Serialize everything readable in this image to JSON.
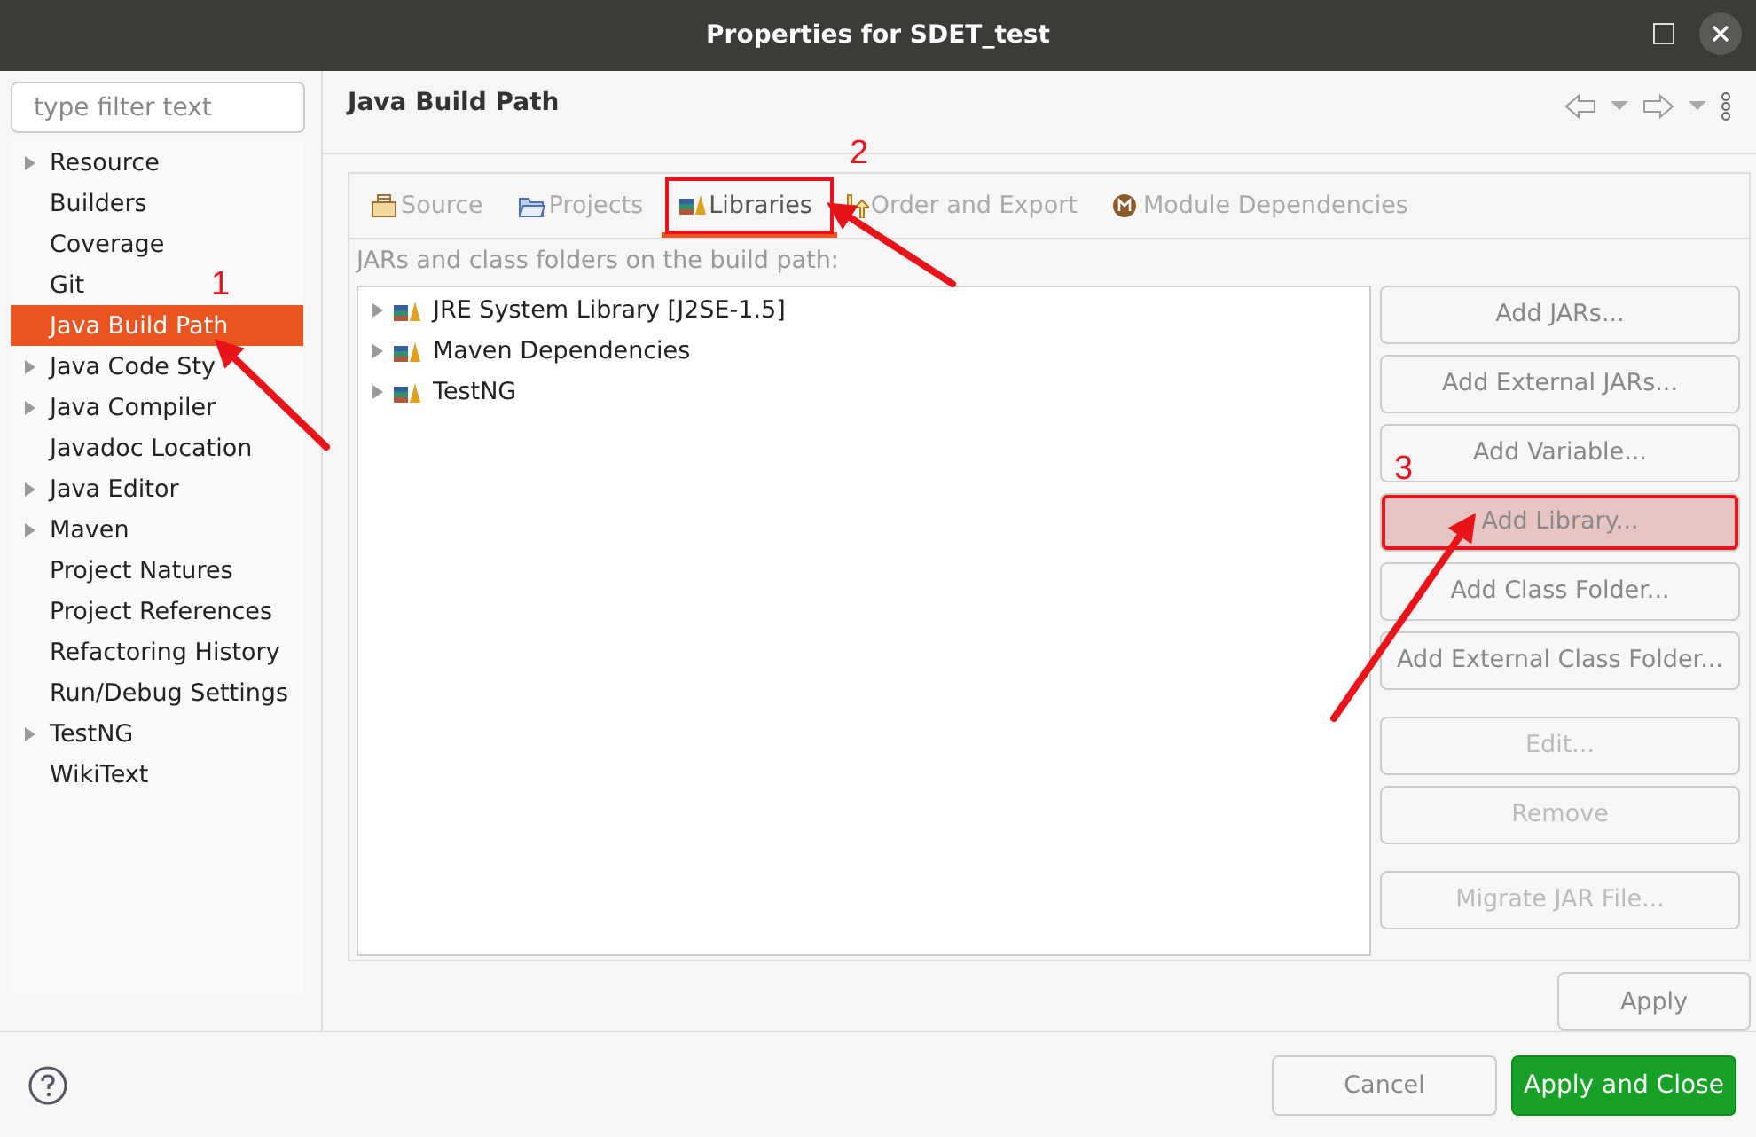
{
  "window": {
    "title": "Properties for SDET_test"
  },
  "filter": {
    "placeholder": "type filter text"
  },
  "sidebar": {
    "items": [
      {
        "label": "Resource",
        "has_children": true,
        "selected": false
      },
      {
        "label": "Builders",
        "has_children": false,
        "selected": false
      },
      {
        "label": "Coverage",
        "has_children": false,
        "selected": false
      },
      {
        "label": "Git",
        "has_children": false,
        "selected": false
      },
      {
        "label": "Java Build Path",
        "has_children": false,
        "selected": true
      },
      {
        "label": "Java Code Sty",
        "has_children": true,
        "selected": false
      },
      {
        "label": "Java Compiler",
        "has_children": true,
        "selected": false
      },
      {
        "label": "Javadoc Location",
        "has_children": false,
        "selected": false
      },
      {
        "label": "Java Editor",
        "has_children": true,
        "selected": false
      },
      {
        "label": "Maven",
        "has_children": true,
        "selected": false
      },
      {
        "label": "Project Natures",
        "has_children": false,
        "selected": false
      },
      {
        "label": "Project References",
        "has_children": false,
        "selected": false
      },
      {
        "label": "Refactoring History",
        "has_children": false,
        "selected": false
      },
      {
        "label": "Run/Debug Settings",
        "has_children": false,
        "selected": false
      },
      {
        "label": "TestNG",
        "has_children": true,
        "selected": false
      },
      {
        "label": "WikiText",
        "has_children": false,
        "selected": false
      }
    ]
  },
  "page": {
    "title": "Java Build Path"
  },
  "tabs": [
    {
      "label": "Source",
      "kind": "source",
      "selected": false,
      "annotated": false
    },
    {
      "label": "Projects",
      "kind": "projects",
      "selected": false,
      "annotated": false
    },
    {
      "label": "Libraries",
      "kind": "libraries",
      "selected": true,
      "annotated": true
    },
    {
      "label": "Order and Export",
      "kind": "order",
      "selected": false,
      "annotated": false
    },
    {
      "label": "Module Dependencies",
      "kind": "module",
      "selected": false,
      "annotated": false
    }
  ],
  "list_label": "JARs and class folders on the build path:",
  "libraries": [
    {
      "label": "JRE System Library [J2SE-1.5]",
      "expanded": false
    },
    {
      "label": "Maven Dependencies",
      "expanded": false
    },
    {
      "label": "TestNG",
      "expanded": false
    }
  ],
  "side_buttons": [
    {
      "label": "Add JARs...",
      "disabled": false,
      "annotated": false
    },
    {
      "label": "Add External JARs...",
      "disabled": false,
      "annotated": false
    },
    {
      "label": "Add Variable...",
      "disabled": false,
      "annotated": false
    },
    {
      "label": "Add Library...",
      "disabled": false,
      "annotated": true
    },
    {
      "label": "Add Class Folder...",
      "disabled": false,
      "annotated": false
    },
    {
      "label": "Add External Class Folder...",
      "disabled": false,
      "annotated": false
    },
    {
      "label": "Edit...",
      "disabled": true,
      "annotated": false
    },
    {
      "label": "Remove",
      "disabled": true,
      "annotated": false
    },
    {
      "label": "Migrate JAR File...",
      "disabled": true,
      "annotated": false
    }
  ],
  "apply_button": "Apply",
  "footer": {
    "cancel": "Cancel",
    "apply_close": "Apply and Close"
  },
  "annotations": [
    {
      "label": "1"
    },
    {
      "label": "2"
    },
    {
      "label": "3"
    }
  ]
}
